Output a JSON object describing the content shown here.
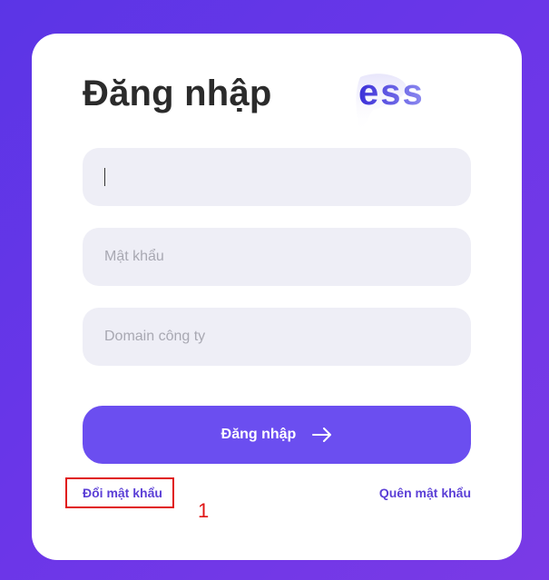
{
  "login": {
    "title": "Đăng nhập",
    "logo_text": "ess",
    "username": {
      "value": "",
      "placeholder": ""
    },
    "password": {
      "value": "",
      "placeholder": "Mật khẩu"
    },
    "domain": {
      "value": "",
      "placeholder": "Domain công ty"
    },
    "submit_label": "Đăng nhập",
    "change_password_link": "Đổi mật khẩu",
    "forgot_password_link": "Quên mật khẩu"
  },
  "annotation": {
    "label": "1"
  },
  "colors": {
    "background": "#6236e6",
    "card": "#ffffff",
    "field": "#eeeef6",
    "primary": "#6b4ef0",
    "link": "#5b3fd6",
    "annotation": "#e01515"
  }
}
